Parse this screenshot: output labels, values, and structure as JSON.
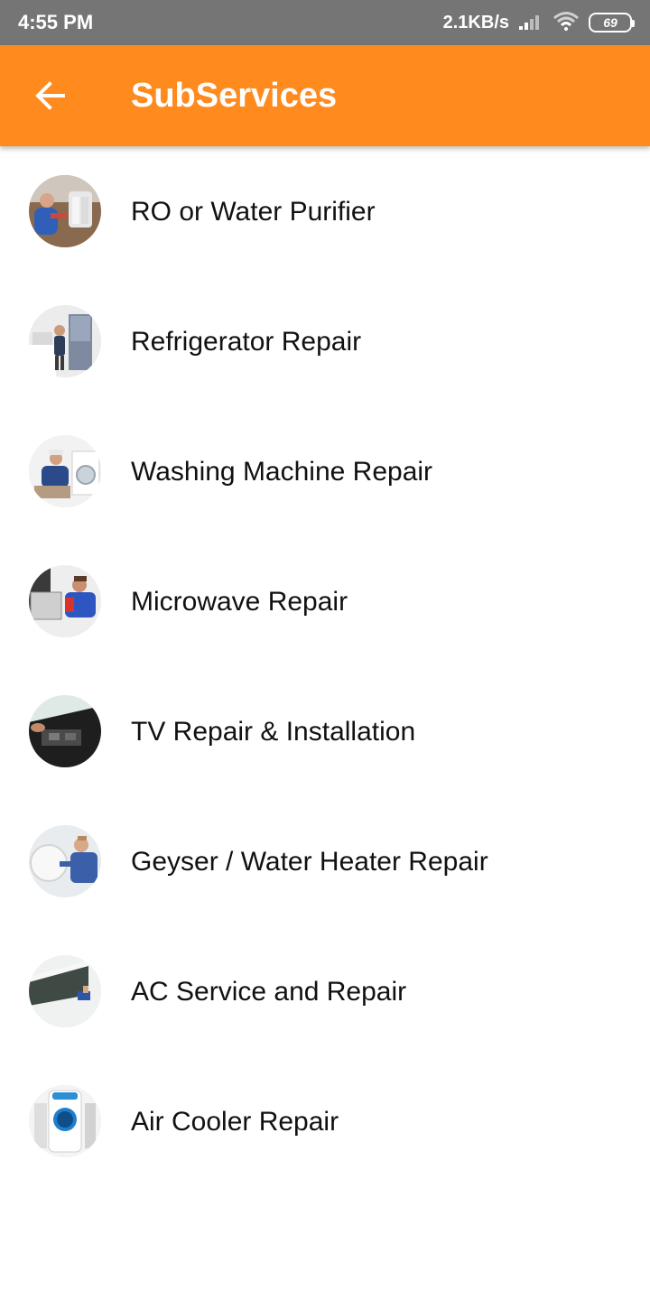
{
  "status_bar": {
    "time": "4:55 PM",
    "speed": "2.1KB/s",
    "battery_level": "69",
    "icons": [
      "signal-icon",
      "wifi-icon",
      "battery-icon"
    ]
  },
  "app_bar": {
    "title": "SubServices",
    "background_color": "#ff8a1e",
    "back_icon": "arrow-left-icon"
  },
  "services": [
    {
      "label": "RO or Water Purifier",
      "image": "ro-purifier-technician-image"
    },
    {
      "label": "Refrigerator Repair",
      "image": "refrigerator-technician-image"
    },
    {
      "label": "Washing Machine Repair",
      "image": "washing-machine-technician-image"
    },
    {
      "label": "Microwave Repair",
      "image": "microwave-technician-image"
    },
    {
      "label": "TV Repair & Installation",
      "image": "tv-repair-image"
    },
    {
      "label": "Geyser / Water Heater Repair",
      "image": "geyser-technician-image"
    },
    {
      "label": "AC Service and Repair",
      "image": "ac-technician-image"
    },
    {
      "label": "Air Cooler Repair",
      "image": "air-cooler-image"
    }
  ]
}
